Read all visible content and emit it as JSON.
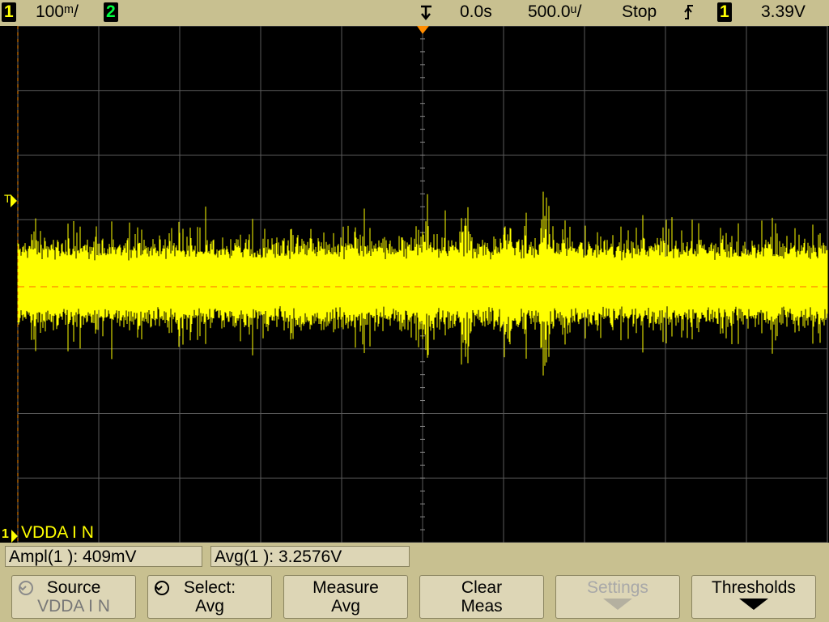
{
  "status_bar": {
    "ch1_label": "1",
    "ch1_scale": "100ᵐ/",
    "ch2_label": "2",
    "time_offset": "0.0s",
    "time_scale": "500.0ᵘ/",
    "run_state": "Stop",
    "trigger_slope_icon": "rising-edge-icon",
    "trigger_source": "1",
    "trigger_level": "3.39V"
  },
  "screen": {
    "channel_marker": "1",
    "channel_name": "VDDA I N",
    "trigger_level_marker": "T",
    "colors": {
      "trace": "#ffff00",
      "grid": "#5a5a5a",
      "reference": "#ff6a00"
    }
  },
  "measurements": [
    {
      "label": "Ampl(1 ): 409mV"
    },
    {
      "label": "Avg(1 ): 3.2576V"
    }
  ],
  "softkeys": [
    {
      "line1": "Source",
      "line2": "VDDA I N",
      "enabled": true,
      "icon": "cycle-icon"
    },
    {
      "line1": "Select:",
      "line2": "Avg",
      "enabled": true,
      "icon": "cycle-icon"
    },
    {
      "line1": "Measure",
      "line2": "Avg",
      "enabled": true
    },
    {
      "line1": "Clear",
      "line2": "Meas",
      "enabled": true
    },
    {
      "line1": "Settings",
      "enabled": false,
      "icon": "down-arrow-icon"
    },
    {
      "line1": "Thresholds",
      "enabled": true,
      "icon": "down-arrow-icon"
    }
  ]
}
